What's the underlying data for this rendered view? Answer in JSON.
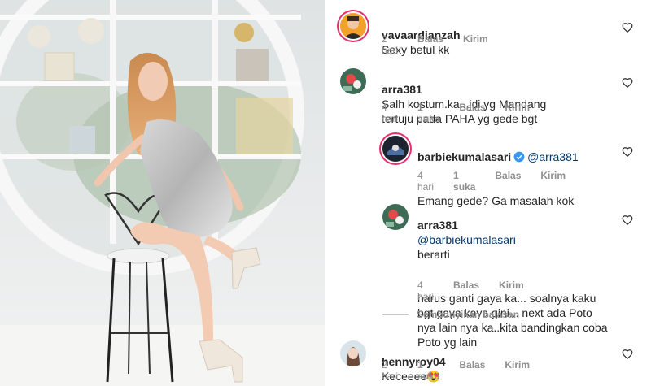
{
  "comments": [
    {
      "username": "vavaardianzah",
      "text": "Sexy betul kk",
      "time": "2 hari",
      "reply": "Balas",
      "send": "Kirim"
    },
    {
      "username": "arra381",
      "text": "Salh kostum.ka...jdi yg Mandang\ntertuju pada PAHA yg gede bgt",
      "time": "4 hari",
      "likes": "1 suka",
      "reply": "Balas",
      "send": "Kirim"
    },
    {
      "username": "barbiekumalasari",
      "mention": "@arra381",
      "text": "Emang gede? Ga masalah kok",
      "time": "4 hari",
      "likes": "1 suka",
      "reply": "Balas",
      "send": "Kirim"
    },
    {
      "username": "arra381",
      "mention": "@barbiekumalasari",
      "text_first": "berarti",
      "text": "harus ganti gaya ka... soalnya kaku\nbgt gaya kaya gini... next ada Poto\nnya lain nya ka..kita bandingkan coba\nPoto yg lain",
      "time": "4 hari",
      "reply": "Balas",
      "send": "Kirim"
    },
    {
      "username": "hennyroy04",
      "text": "Keceeee😍",
      "time": "2 hari",
      "likes": "1 suka",
      "reply": "Balas",
      "send": "Kirim"
    }
  ],
  "hide_replies": "Sembunyikan balasan",
  "colors": {
    "text": "#262626",
    "muted": "#8e8e8e",
    "mention": "#00376b",
    "verified": "#3897f0",
    "story_ring": "#e1306c"
  }
}
